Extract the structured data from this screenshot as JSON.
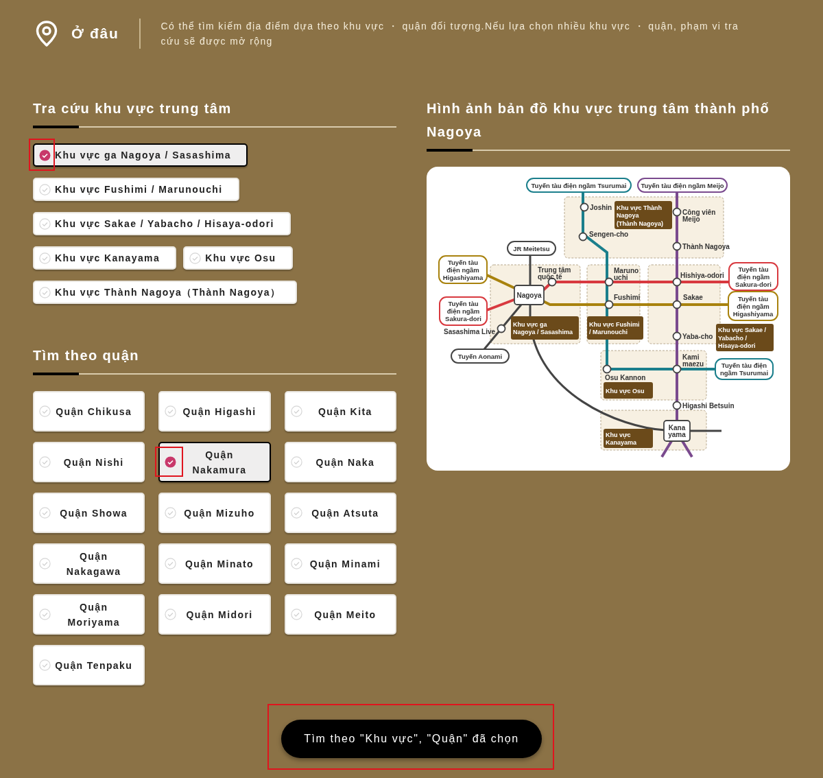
{
  "header": {
    "title": "Ở đâu",
    "description": "Có thể tìm kiếm địa điểm dựa theo khu vực ・ quận đối tượng.Nếu lựa chọn nhiều khu vực ・ quận, phạm vi tra cứu sẽ được mở rộng"
  },
  "area_section": {
    "title": "Tra cứu khu vực trung tâm",
    "items": [
      {
        "label": "Khu vực ga Nagoya / Sasashima",
        "selected": true,
        "highlighted": true
      },
      {
        "label": "Khu vực Fushimi / Marunouchi",
        "selected": false,
        "highlighted": false
      },
      {
        "label": "Khu vực Sakae / Yabacho / Hisaya-odori",
        "selected": false,
        "highlighted": false
      },
      {
        "label": "Khu vực Kanayama",
        "selected": false,
        "highlighted": false
      },
      {
        "label": "Khu vực Osu",
        "selected": false,
        "highlighted": false
      },
      {
        "label": "Khu vực Thành Nagoya（Thành Nagoya）",
        "selected": false,
        "highlighted": false
      }
    ]
  },
  "ward_section": {
    "title": "Tìm theo quận",
    "items": [
      {
        "label": "Quận Chikusa",
        "selected": false,
        "highlighted": false
      },
      {
        "label": "Quận Higashi",
        "selected": false,
        "highlighted": false
      },
      {
        "label": "Quận Kita",
        "selected": false,
        "highlighted": false
      },
      {
        "label": "Quận Nishi",
        "selected": false,
        "highlighted": false
      },
      {
        "label": "Quận Nakamura",
        "selected": true,
        "highlighted": true
      },
      {
        "label": "Quận Naka",
        "selected": false,
        "highlighted": false
      },
      {
        "label": "Quận Showa",
        "selected": false,
        "highlighted": false
      },
      {
        "label": "Quận Mizuho",
        "selected": false,
        "highlighted": false
      },
      {
        "label": "Quận Atsuta",
        "selected": false,
        "highlighted": false
      },
      {
        "label": "Quận Nakagawa",
        "selected": false,
        "highlighted": false
      },
      {
        "label": "Quận Minato",
        "selected": false,
        "highlighted": false
      },
      {
        "label": "Quận Minami",
        "selected": false,
        "highlighted": false
      },
      {
        "label": "Quận Moriyama",
        "selected": false,
        "highlighted": false
      },
      {
        "label": "Quận Midori",
        "selected": false,
        "highlighted": false
      },
      {
        "label": "Quận Meito",
        "selected": false,
        "highlighted": false
      },
      {
        "label": "Quận Tenpaku",
        "selected": false,
        "highlighted": false
      }
    ]
  },
  "map_section": {
    "title": "Hình ảnh bản đồ khu vực trung tâm thành phố Nagoya",
    "map": {
      "line_labels": [
        {
          "lines": [
            "Tuyến tàu điện ngầm Tsurumai"
          ],
          "color": "#1b7f8c"
        },
        {
          "lines": [
            "Tuyến tàu điện ngầm Meijo"
          ],
          "color": "#7a4a8e"
        },
        {
          "lines": [
            "JR Meitetsu"
          ],
          "color": "#444444"
        },
        {
          "lines": [
            "Tuyến tàu",
            "điện ngầm",
            "Higashiyama"
          ],
          "color": "#a8820e"
        },
        {
          "lines": [
            "Tuyến tàu",
            "điện ngầm",
            "Sakura-dori"
          ],
          "color": "#d8393f"
        },
        {
          "lines": [
            "Tuyến Aonami"
          ],
          "color": "#444444"
        },
        {
          "lines": [
            "Tuyến tàu",
            "điện ngầm",
            "Sakura-dori"
          ],
          "color": "#d8393f"
        },
        {
          "lines": [
            "Tuyến tàu",
            "điện ngầm",
            "Higashiyama"
          ],
          "color": "#a8820e"
        },
        {
          "lines": [
            "Tuyến tàu điện",
            "ngầm Tsurumai"
          ],
          "color": "#1b7f8c"
        }
      ],
      "stations": [
        {
          "kind": "stop",
          "lines": [
            "Joshin"
          ]
        },
        {
          "kind": "stop",
          "lines": [
            "Sengen-cho"
          ]
        },
        {
          "kind": "stop",
          "lines": [
            "Công viên",
            "Meijo"
          ]
        },
        {
          "kind": "stop",
          "lines": [
            "Thành Nagoya"
          ]
        },
        {
          "kind": "stop",
          "lines": [
            "Trung tâm",
            "quốc tế"
          ]
        },
        {
          "kind": "stop",
          "lines": [
            "Maruno",
            "uchi"
          ]
        },
        {
          "kind": "stop",
          "lines": [
            "Hishiya-odori"
          ]
        },
        {
          "kind": "stop",
          "lines": [
            "Fushimi"
          ]
        },
        {
          "kind": "stop",
          "lines": [
            "Sakae"
          ]
        },
        {
          "kind": "stop",
          "lines": [
            "Sasashima Live"
          ]
        },
        {
          "kind": "stop",
          "lines": [
            "Yaba-cho"
          ]
        },
        {
          "kind": "stop",
          "lines": [
            "Kami",
            "maezu"
          ]
        },
        {
          "kind": "stop",
          "lines": [
            "Osu Kannon"
          ]
        },
        {
          "kind": "stop",
          "lines": [
            "Higashi Betsuin"
          ]
        },
        {
          "kind": "hub",
          "lines": [
            "Nagoya"
          ]
        },
        {
          "kind": "hub",
          "lines": [
            "Kana",
            "yama"
          ]
        }
      ],
      "area_labels": [
        {
          "lines": [
            "Khu vực Thành",
            "Nagoya",
            "(Thành Nagoya)"
          ]
        },
        {
          "lines": [
            "Khu vực ga",
            "Nagoya / Sasashima"
          ]
        },
        {
          "lines": [
            "Khu vực Fushimi",
            "/ Marunouchi"
          ]
        },
        {
          "lines": [
            "Khu vực Sakae /",
            "Yabacho /",
            "Hisaya-odori"
          ]
        },
        {
          "lines": [
            "Khu vực Osu"
          ]
        },
        {
          "lines": [
            "Khu vực",
            "Kanayama"
          ]
        }
      ]
    }
  },
  "search_button": {
    "label": "Tìm theo \"Khu vực\", \"Quận\" đã chọn",
    "highlighted": true
  }
}
